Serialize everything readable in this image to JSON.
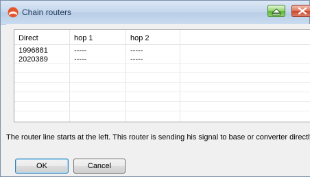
{
  "window": {
    "title": "Chain routers",
    "colors": {
      "titlebar": "#c5d7ec",
      "minimize": "#5fb43a",
      "close": "#c8462c"
    }
  },
  "table": {
    "columns": [
      "Direct",
      "hop 1",
      "hop 2"
    ],
    "rows": [
      [
        "1996881",
        "-----",
        "-----"
      ],
      [
        "2020389",
        "-----",
        "-----"
      ]
    ]
  },
  "hint": "The router line starts at the left. This router is sending his signal to base or converter directly",
  "buttons": {
    "ok": "OK",
    "cancel": "Cancel"
  },
  "icons": {
    "app": "testo-app-icon",
    "minimize": "minimize-icon",
    "close": "close-icon"
  }
}
